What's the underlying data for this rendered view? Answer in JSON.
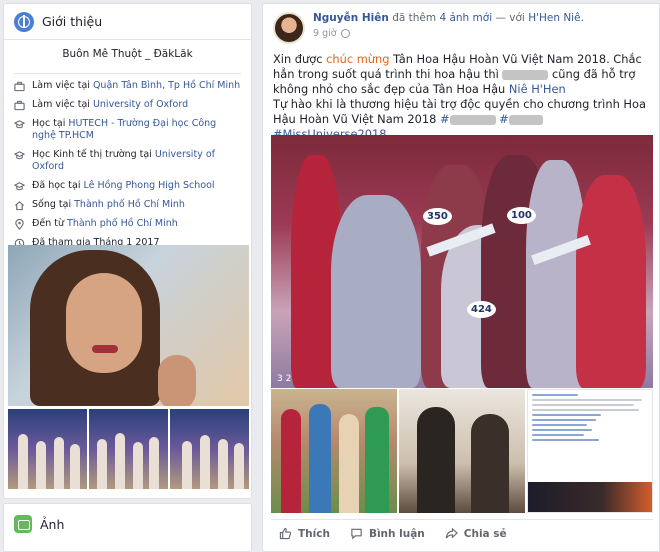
{
  "intro": {
    "title": "Giới thiệu",
    "bio": "Buôn Mê Thuột _ ĐăkLăk",
    "items": [
      {
        "icon": "briefcase-icon",
        "prefix": "Làm việc tại ",
        "link": "Quận Tân Bình, Tp Hồ Chí Minh"
      },
      {
        "icon": "briefcase-icon",
        "prefix": "Làm việc tại ",
        "link": "University of Oxford"
      },
      {
        "icon": "graduation-cap-icon",
        "prefix": "Học tại ",
        "link": "HUTECH - Trường Đại học Công nghệ TP.HCM"
      },
      {
        "icon": "graduation-cap-icon",
        "prefix": "Học Kinh tế thị trường tại ",
        "link": "University of Oxford"
      },
      {
        "icon": "graduation-cap-icon",
        "prefix": "Đã học tại ",
        "link": "Lê Hồng Phong High School"
      },
      {
        "icon": "home-icon",
        "prefix": "Sống tại ",
        "link": "Thành phố Hồ Chí Minh"
      },
      {
        "icon": "location-pin-icon",
        "prefix": "Đến từ ",
        "link": "Thành phố Hồ Chí Minh"
      },
      {
        "icon": "clock-icon",
        "prefix": "Đã tham gia Tháng 1 2017",
        "link": ""
      }
    ]
  },
  "photos": {
    "title": "Ảnh"
  },
  "post": {
    "author": "Nguyễn Hiên",
    "meta_mid": " đã thêm ",
    "meta_count": "4 ảnh mới",
    "meta_with": " — với ",
    "meta_tag": "H'Hen Niê",
    "meta_end": ".",
    "time": "9 giờ",
    "text": {
      "p1_start": "Xin được ",
      "p1_highlight": "chúc mừng",
      "p1_mid": " Tân Hoa Hậu Hoàn Vũ Việt Nam 2018. Chắc hẳn trong suốt quá trình thi hoa hậu thì ",
      "p1_after_blur": " cũng đã hỗ trợ không nhỏ cho sắc đẹp của Tân Hoa Hậu ",
      "p1_link": "Niê H'Hen",
      "p2": "Tự hào khi là thương hiệu tài trợ độc quyền cho chương trình Hoa Hậu Hoàn Vũ Việt Nam 2018 ",
      "hash_prefix1": "#",
      "hash_prefix2": " #",
      "hash_final": " #MissUniverse2018"
    },
    "photo_badges": [
      "350",
      "100",
      "424"
    ],
    "photo_corner": "3 2",
    "actions": {
      "like": "Thích",
      "comment": "Bình luận",
      "share": "Chia sẻ"
    }
  }
}
